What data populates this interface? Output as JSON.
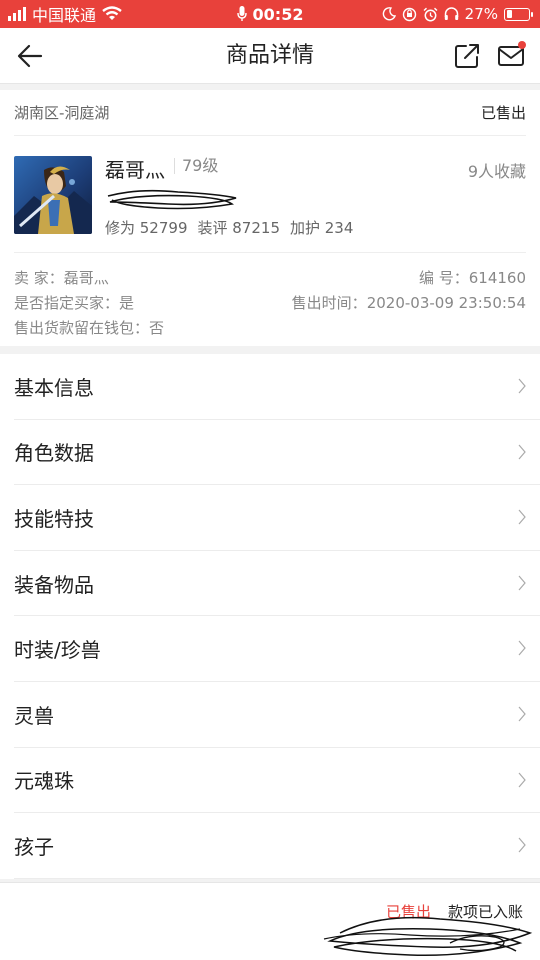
{
  "status_bar": {
    "carrier": "中国联通",
    "time": "00:52",
    "battery": "27%",
    "battery_level": 0.27
  },
  "nav": {
    "title": "商品详情",
    "back_icon": "back-arrow-icon",
    "share_icon": "share-icon",
    "message_icon": "mail-icon"
  },
  "listing": {
    "location": "湖南区-洞庭湖",
    "sold_tag": "已售出",
    "name": "磊哥灬",
    "level": "79级",
    "favorites": "9人收藏",
    "stats": [
      "修为 52799",
      "装评 87215",
      "加护 234"
    ],
    "seller_label": "卖 家：",
    "seller": "磊哥灬",
    "id_label": "编 号：",
    "id": "614160",
    "designated_buyer_label": "是否指定买家：",
    "designated_buyer": "是",
    "sold_time_label": "售出时间：",
    "sold_time": "2020-03-09 23:50:54",
    "wallet_label": "售出货款留在钱包：",
    "wallet": "否"
  },
  "menu": [
    {
      "label": "基本信息"
    },
    {
      "label": "角色数据"
    },
    {
      "label": "技能特技"
    },
    {
      "label": "装备物品"
    },
    {
      "label": "时装/珍兽"
    },
    {
      "label": "灵兽"
    },
    {
      "label": "元魂珠"
    },
    {
      "label": "孩子"
    }
  ],
  "bottom": {
    "status": "已售出",
    "note": "款项已入账"
  },
  "colors": {
    "accent": "#e8413b"
  }
}
